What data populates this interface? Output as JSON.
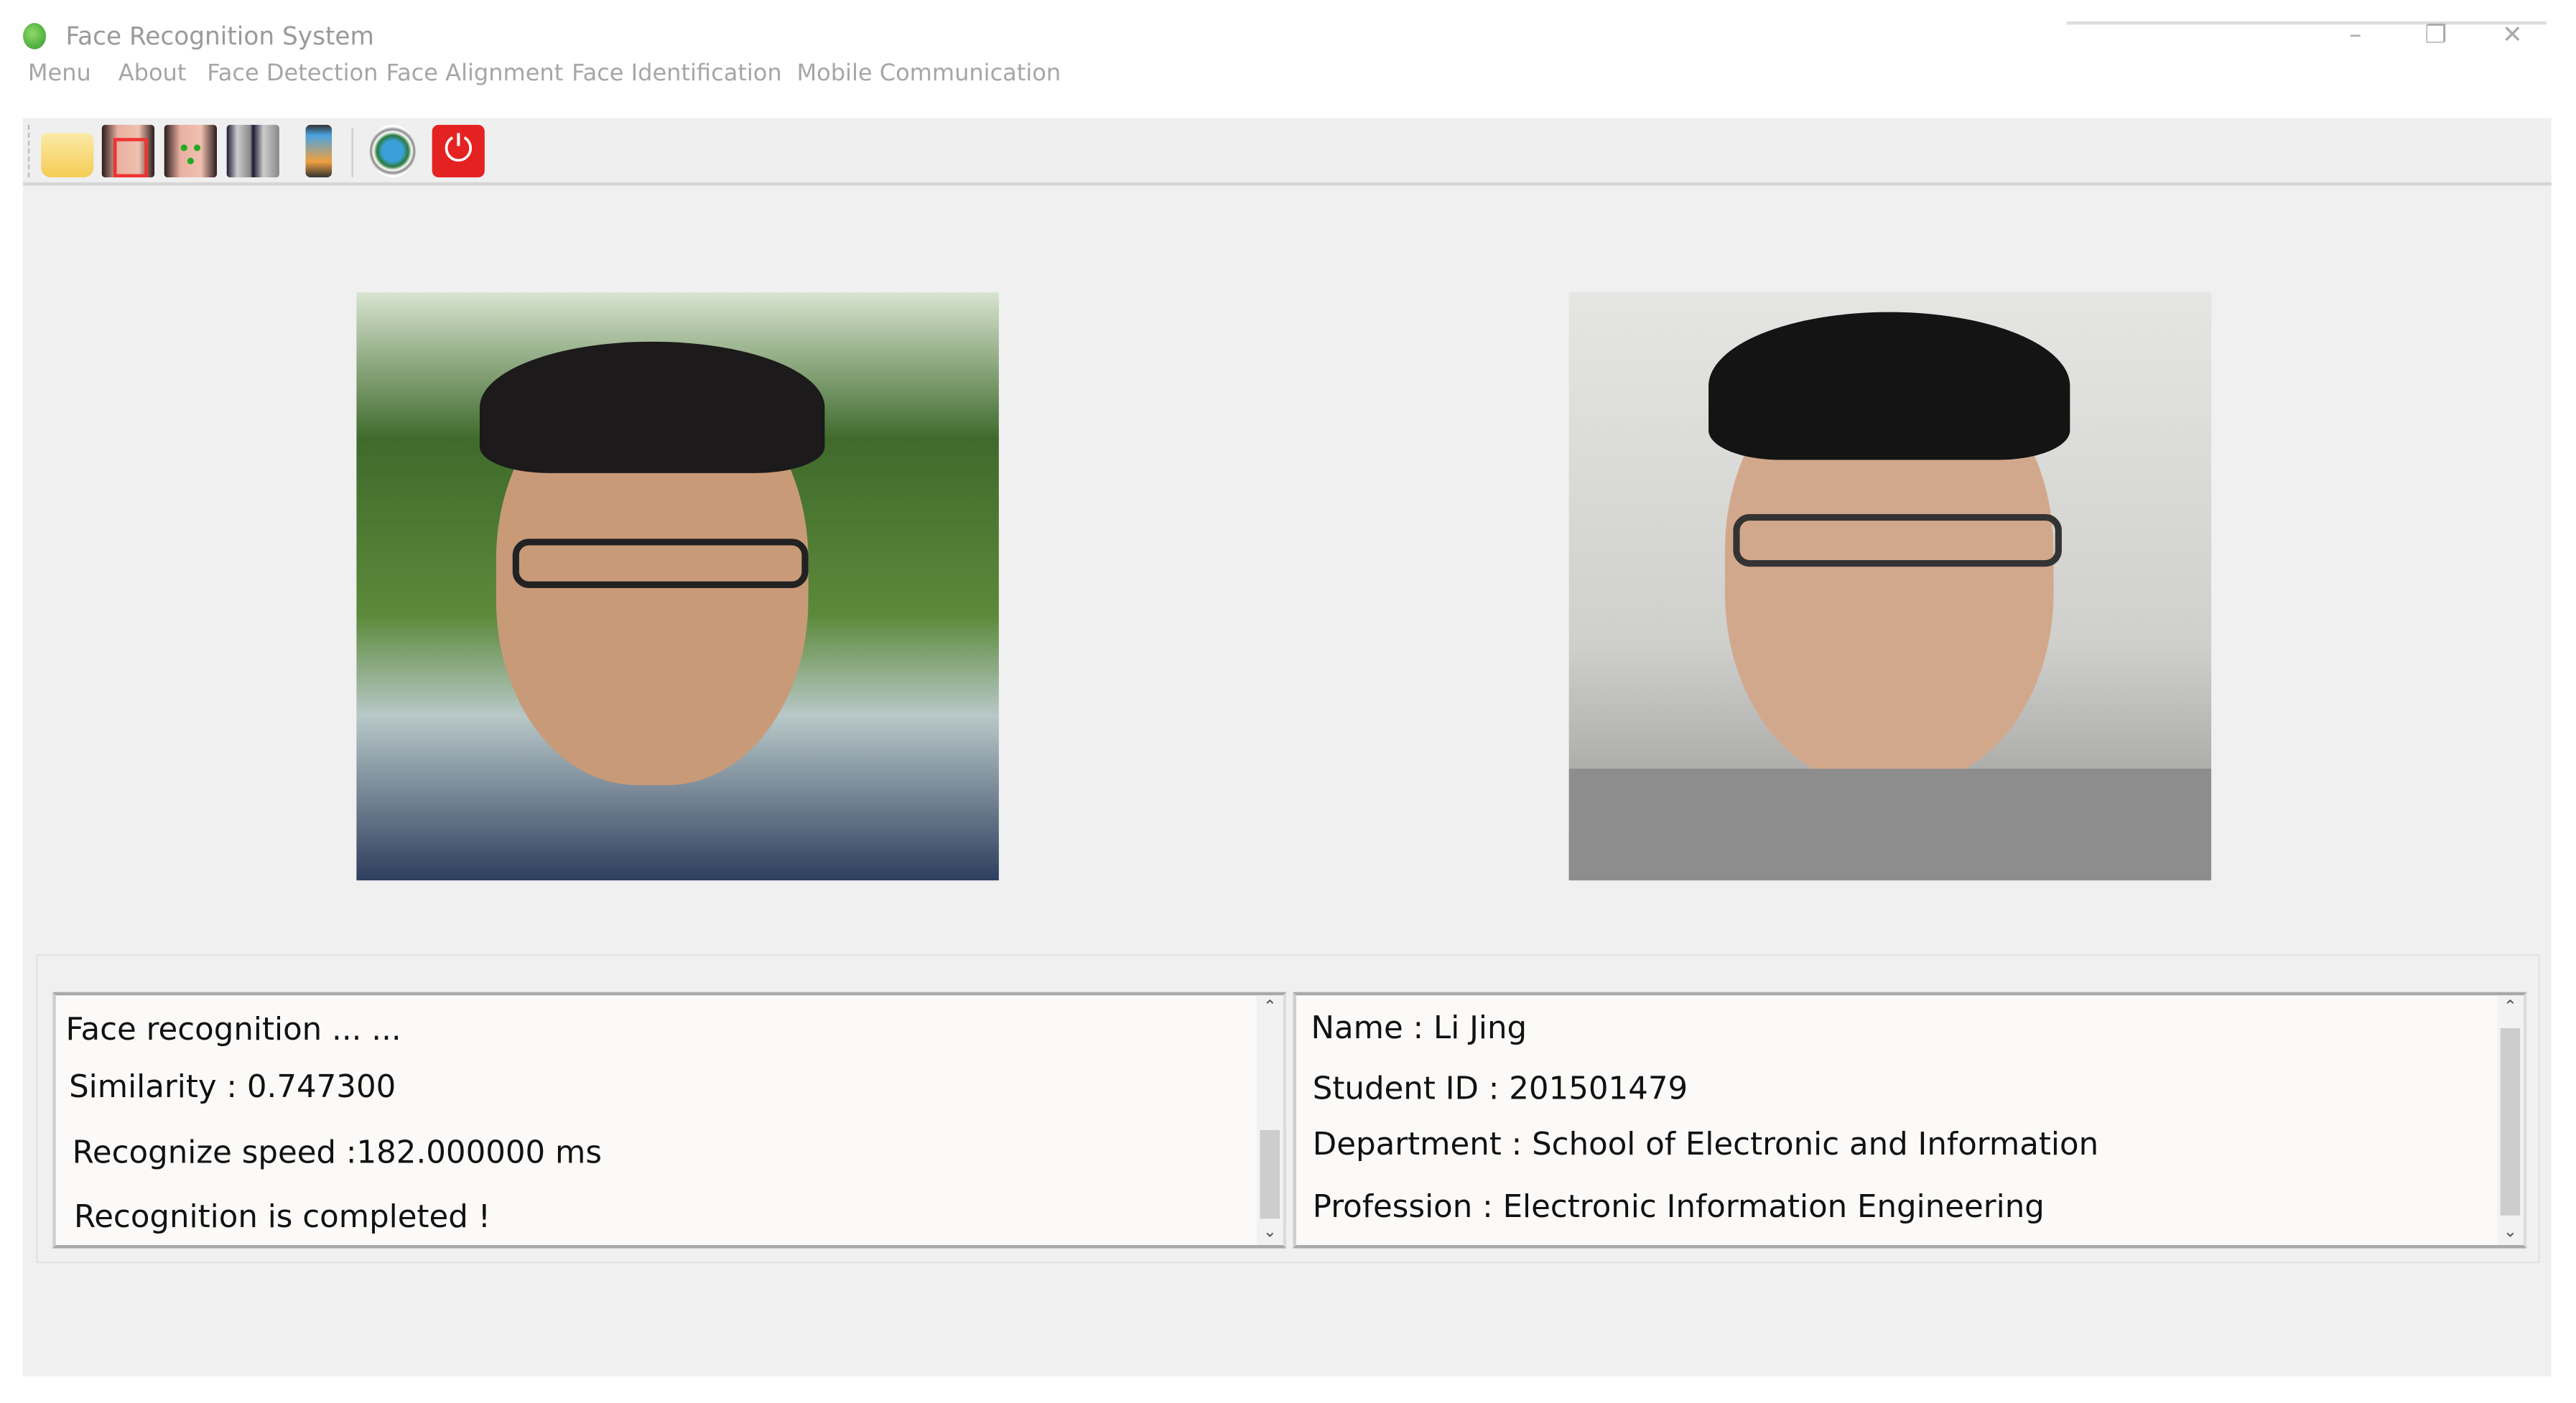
{
  "window": {
    "title": "Face Recognition System",
    "minimize": "–",
    "maximize": "❐",
    "close": "✕"
  },
  "menu": [
    "Menu",
    "About",
    "Face Detection",
    "Face Alignment",
    "Face Identification",
    "Mobile Communication"
  ],
  "toolbar": [
    "open-folder-icon",
    "face-detection-icon",
    "face-alignment-icon",
    "face-identification-icon",
    "mobile-communication-icon",
    "university-logo-icon",
    "power-icon"
  ],
  "log_panel": {
    "lines": [
      "Face recognition ... ...",
      "Similarity  : 0.747300",
      "Recognize speed :182.000000 ms",
      "Recognition is completed !"
    ],
    "scroll_position": 0.75
  },
  "info_panel": {
    "lines": [
      "Name : Li Jing",
      "Student ID : 201501479",
      "Department : School of Electronic and Information",
      "Profession : Electronic Information Engineering"
    ],
    "scroll_position": 0.9
  },
  "colors": {
    "bg": "#f0f0f0",
    "power": "#e52222",
    "folder": "#f7d66a"
  }
}
